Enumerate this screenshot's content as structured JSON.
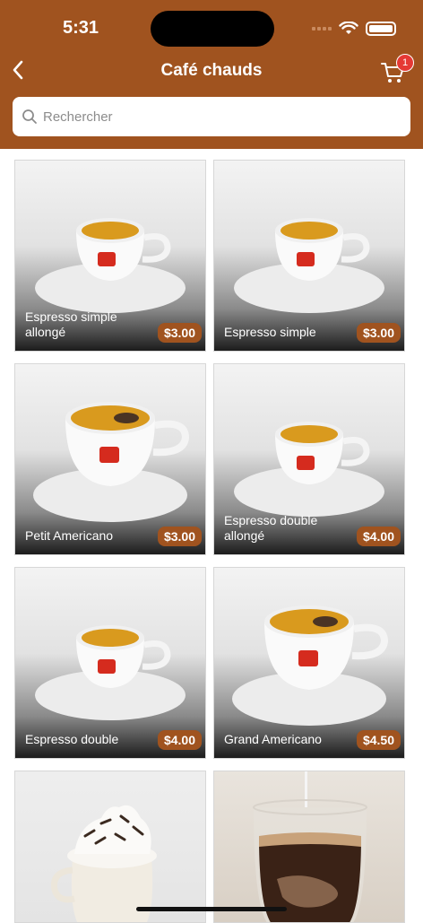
{
  "status_bar": {
    "time": "5:31"
  },
  "header": {
    "title": "Café chauds",
    "cart_count": "1"
  },
  "search": {
    "placeholder": "Rechercher"
  },
  "products": [
    {
      "name": "Espresso simple allongé",
      "price": "$3.00",
      "image": "espresso-cup"
    },
    {
      "name": "Espresso simple",
      "price": "$3.00",
      "image": "espresso-cup"
    },
    {
      "name": "Petit Americano",
      "price": "$3.00",
      "image": "americano-cup"
    },
    {
      "name": "Espresso double allongé",
      "price": "$4.00",
      "image": "espresso-cup"
    },
    {
      "name": "Espresso double",
      "price": "$4.00",
      "image": "espresso-cup"
    },
    {
      "name": "Grand Americano",
      "price": "$4.50",
      "image": "americano-cup"
    },
    {
      "name": "",
      "price": "",
      "image": "mocha-whipped-cream"
    },
    {
      "name": "",
      "price": "",
      "image": "latte-glass"
    }
  ],
  "colors": {
    "brand": "#a0531f",
    "badge": "#e53935"
  }
}
